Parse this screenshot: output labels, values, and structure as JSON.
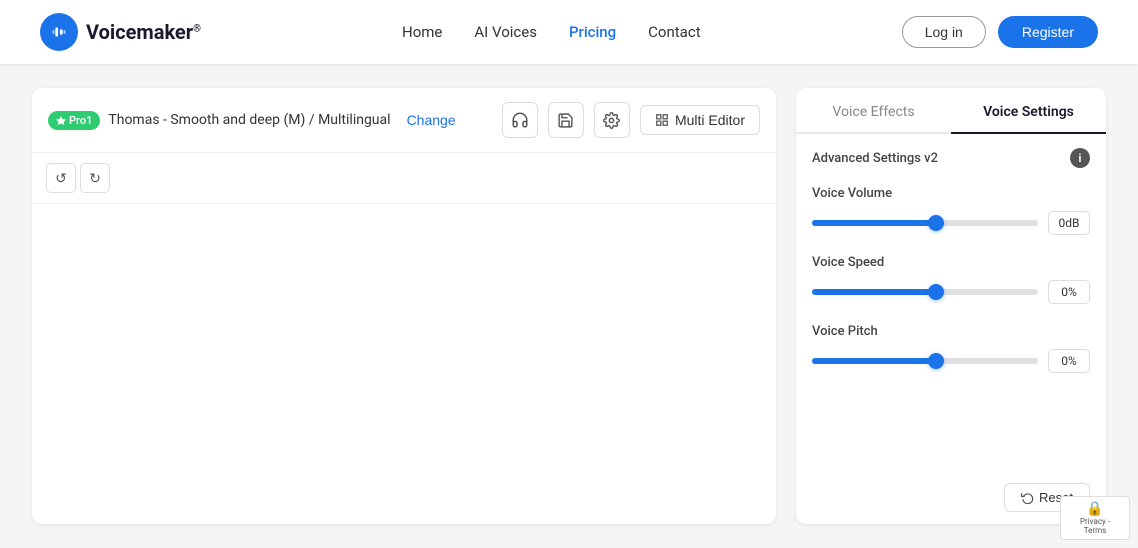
{
  "header": {
    "logo_text": "Voicemaker",
    "logo_sup": "®",
    "nav": [
      {
        "label": "Home",
        "active": false
      },
      {
        "label": "AI Voices",
        "active": false
      },
      {
        "label": "Pricing",
        "active": false
      },
      {
        "label": "Contact",
        "active": false
      }
    ],
    "login_label": "Log in",
    "register_label": "Register"
  },
  "editor": {
    "pro_badge": "Pro1",
    "voice_name": "Thomas - Smooth and deep (M) / Multilingual",
    "change_label": "Change",
    "undo_icon": "↺",
    "redo_icon": "↻",
    "multi_editor_label": "Multi Editor"
  },
  "right_panel": {
    "tab_voice_effects": "Voice Effects",
    "tab_voice_settings": "Voice Settings",
    "advanced_settings_label": "Advanced Settings v2",
    "sliders": [
      {
        "label": "Voice Volume",
        "value": "0dB",
        "fill_pct": 55
      },
      {
        "label": "Voice Speed",
        "value": "0%",
        "fill_pct": 55
      },
      {
        "label": "Voice Pitch",
        "value": "0%",
        "fill_pct": 55
      }
    ],
    "reset_label": "Reset"
  },
  "recaptcha": {
    "label": "Privacy - Terms"
  }
}
